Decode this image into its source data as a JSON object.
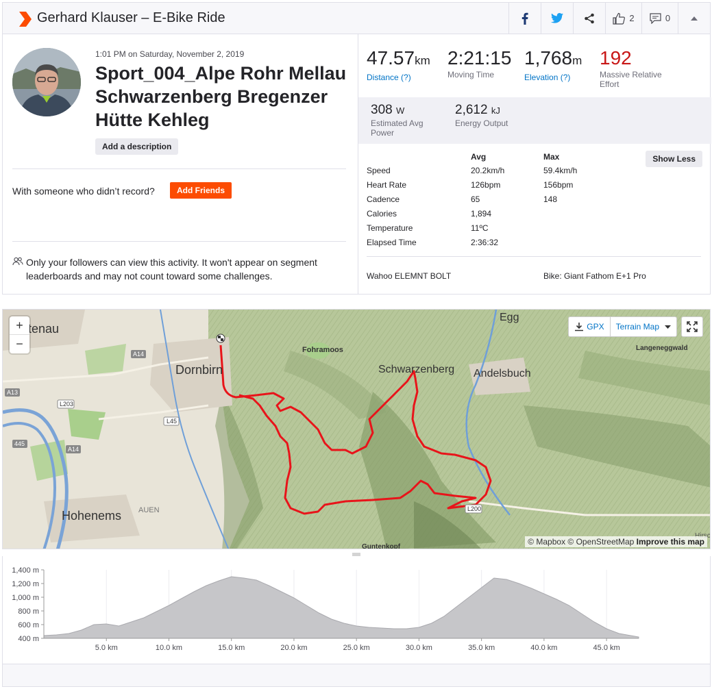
{
  "header": {
    "title": "Gerhard Klauser – E-Bike Ride",
    "kudos_count": "2",
    "comments_count": "0"
  },
  "activity": {
    "datetime": "1:01 PM on Saturday, November 2, 2019",
    "name": "Sport_004_Alpe Rohr Mellau Schwarzenberg Bregenzer Hütte Kehleg",
    "add_description": "Add a description",
    "with_someone": "With someone who didn’t record?",
    "add_friends": "Add Friends",
    "privacy": "Only your followers can view this activity. It won't appear on segment leaderboards and may not count toward some challenges."
  },
  "stats": {
    "distance": {
      "value": "47.57",
      "unit": "km",
      "label": "Distance (?)"
    },
    "moving_time": {
      "value": "2:21:15",
      "label": "Moving Time"
    },
    "elevation": {
      "value": "1,768",
      "unit": "m",
      "label": "Elevation (?)"
    },
    "relative_effort": {
      "value": "192",
      "label": "Massive Relative Effort"
    },
    "power": {
      "value": "308",
      "unit": "W",
      "label": "Estimated Avg Power"
    },
    "energy": {
      "value": "2,612",
      "unit": "kJ",
      "label": "Energy Output"
    }
  },
  "table": {
    "headers": {
      "avg": "Avg",
      "max": "Max"
    },
    "show_less": "Show Less",
    "rows": [
      {
        "label": "Speed",
        "avg": "20.2km/h",
        "max": "59.4km/h"
      },
      {
        "label": "Heart Rate",
        "avg": "126bpm",
        "max": "156bpm"
      },
      {
        "label": "Cadence",
        "avg": "65",
        "max": "148"
      },
      {
        "label": "Calories",
        "avg": "1,894",
        "max": ""
      },
      {
        "label": "Temperature",
        "avg": "11ºC",
        "max": ""
      },
      {
        "label": "Elapsed Time",
        "avg": "2:36:32",
        "max": ""
      }
    ],
    "device": "Wahoo ELEMNT BOLT",
    "bike": "Bike: Giant Fathom E+1 Pro"
  },
  "map": {
    "zoom_in": "+",
    "zoom_out": "−",
    "gpx": "GPX",
    "map_type": "Terrain Map",
    "attribution": "© Mapbox © OpenStreetMap",
    "improve": "Improve this map",
    "places": {
      "lustenau": "stenau",
      "dornbirn": "Dornbirn",
      "hohenems": "Hohenems",
      "auen": "AUEN",
      "fohramoos": "Fohramoos",
      "schwarzenberg": "Schwarzenberg",
      "andelsbuch": "Andelsbuch",
      "egg": "Egg",
      "langenegg": "Langeneggwald",
      "guntenkopf": "Guntenkopf",
      "hirsc": "Hirsc"
    },
    "roads": {
      "a14a": "A14",
      "a14b": "A14",
      "a13": "A13",
      "l203": "L203",
      "l45": "L45",
      "r445": "445",
      "l200": "L200"
    }
  },
  "chart_data": {
    "type": "area",
    "title": "",
    "xlabel": "",
    "ylabel": "",
    "x_ticks": [
      "5.0 km",
      "10.0 km",
      "15.0 km",
      "20.0 km",
      "25.0 km",
      "30.0 km",
      "35.0 km",
      "40.0 km",
      "45.0 km"
    ],
    "y_ticks": [
      "400 m",
      "600 m",
      "800 m",
      "1,000 m",
      "1,200 m",
      "1,400 m"
    ],
    "xlim": [
      0,
      47.57
    ],
    "ylim": [
      400,
      1400
    ],
    "x": [
      0,
      1,
      2,
      3,
      4,
      5,
      6,
      7,
      8,
      9,
      10,
      11,
      12,
      13,
      14,
      15,
      16,
      17,
      18,
      19,
      20,
      21,
      22,
      23,
      24,
      25,
      26,
      27,
      28,
      29,
      30,
      31,
      32,
      33,
      34,
      35,
      36,
      37,
      38,
      39,
      40,
      41,
      42,
      43,
      44,
      45,
      46,
      47.57
    ],
    "values": [
      440,
      450,
      470,
      520,
      600,
      610,
      580,
      640,
      700,
      790,
      880,
      980,
      1080,
      1170,
      1240,
      1300,
      1280,
      1250,
      1170,
      1080,
      990,
      880,
      770,
      680,
      620,
      580,
      560,
      550,
      540,
      540,
      560,
      620,
      720,
      860,
      1000,
      1140,
      1280,
      1260,
      1200,
      1130,
      1050,
      970,
      880,
      760,
      640,
      540,
      470,
      420
    ]
  }
}
